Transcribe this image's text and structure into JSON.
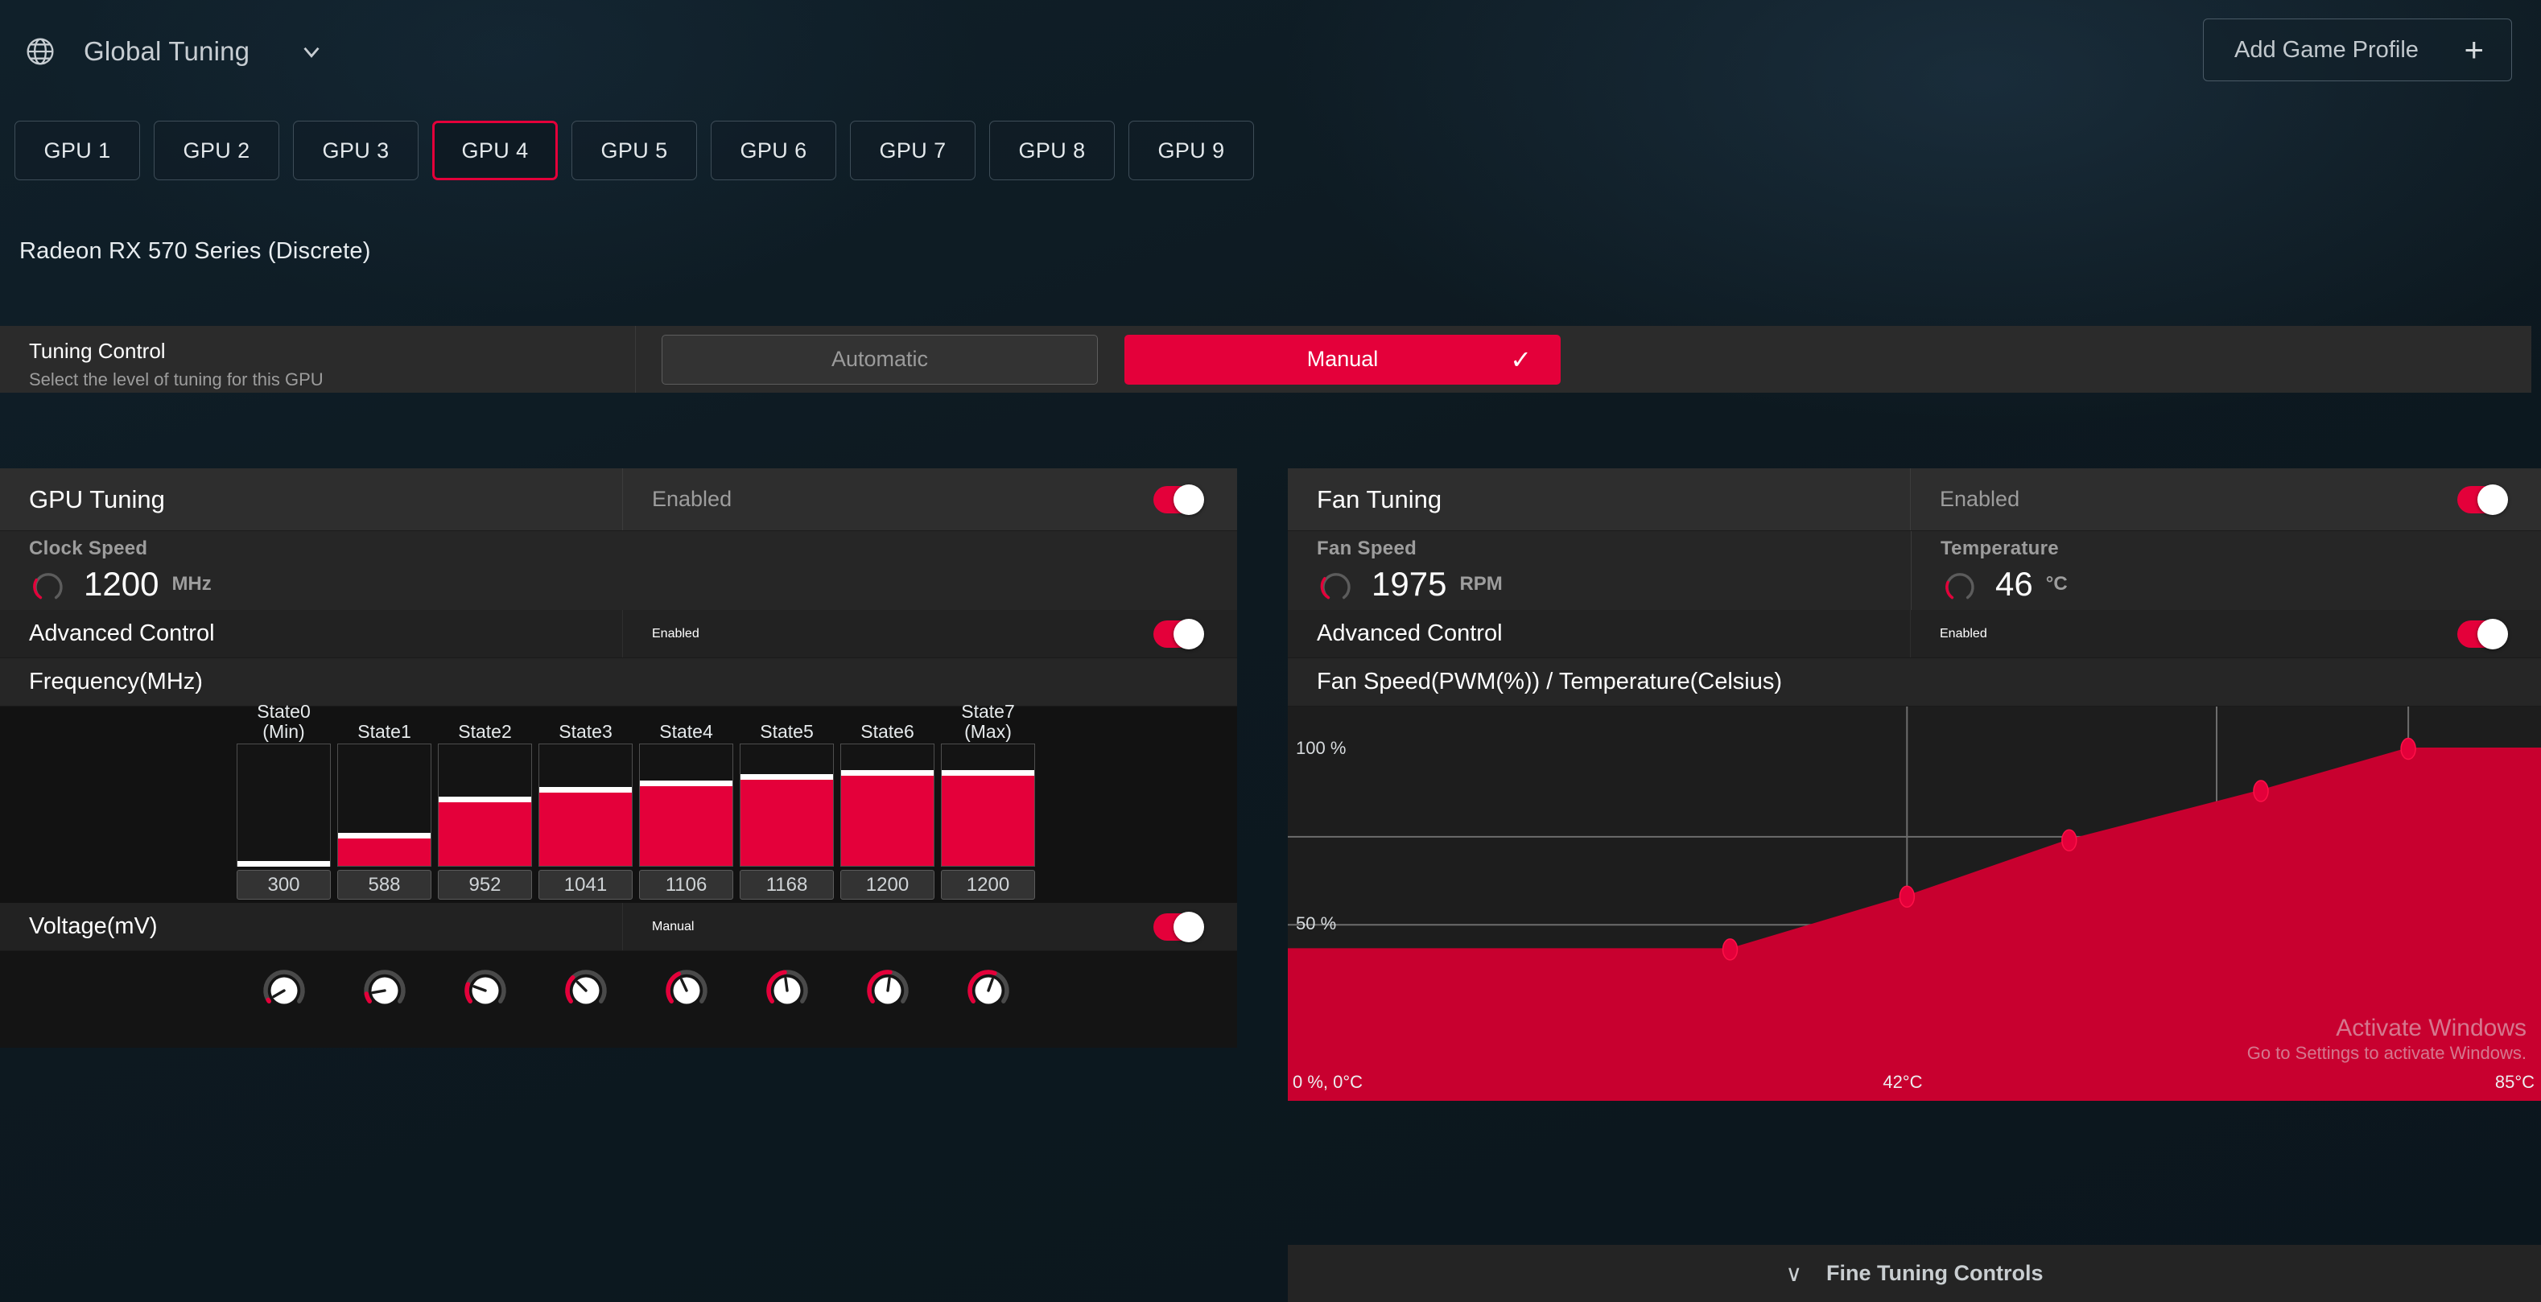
{
  "topbar": {
    "globe_icon": "globe-icon",
    "profile_name": "Global Tuning",
    "chevron_icon": "chevron-down-icon",
    "add_profile_label": "Add Game Profile",
    "add_profile_plus": "+"
  },
  "gpu_tabs": {
    "items": [
      {
        "label": "GPU 1",
        "selected": false
      },
      {
        "label": "GPU 2",
        "selected": false
      },
      {
        "label": "GPU 3",
        "selected": false
      },
      {
        "label": "GPU 4",
        "selected": true
      },
      {
        "label": "GPU 5",
        "selected": false
      },
      {
        "label": "GPU 6",
        "selected": false
      },
      {
        "label": "GPU 7",
        "selected": false
      },
      {
        "label": "GPU 8",
        "selected": false
      },
      {
        "label": "GPU 9",
        "selected": false
      }
    ],
    "selected_index": 3
  },
  "device": {
    "name": "Radeon RX 570 Series (Discrete)"
  },
  "tuning_control": {
    "title": "Tuning Control",
    "subtitle": "Select the level of tuning for this GPU",
    "automatic_label": "Automatic",
    "manual_label": "Manual",
    "selected": "Manual",
    "check_glyph": "✓"
  },
  "gpu_tuning": {
    "title": "GPU Tuning",
    "enabled_label": "Enabled",
    "enabled": true,
    "clock_speed": {
      "label": "Clock Speed",
      "value": "1200",
      "unit": "MHz",
      "gauge_pct": 38
    },
    "advanced_control": {
      "label": "Advanced Control",
      "state_label": "Enabled",
      "enabled": true
    },
    "frequency_label": "Frequency(MHz)",
    "voltage_label": "Voltage(mV)",
    "voltage_mode_label": "Manual",
    "voltage_enabled": true
  },
  "fan_tuning": {
    "title": "Fan Tuning",
    "enabled_label": "Enabled",
    "enabled": true,
    "fan_speed": {
      "label": "Fan Speed",
      "value": "1975",
      "unit": "RPM",
      "gauge_pct": 45
    },
    "temperature": {
      "label": "Temperature",
      "value": "46",
      "unit": "°C",
      "gauge_pct": 30
    },
    "curve_label": "Fan Speed(PWM(%)) / Temperature(Celsius)",
    "fine_tuning_label": "Fine Tuning Controls",
    "fine_tuning_chevron": "∨"
  },
  "watermark": {
    "title": "Activate Windows",
    "subtitle": "Go to Settings to activate Windows."
  },
  "chart_data": [
    {
      "type": "bar",
      "title": "Frequency(MHz)",
      "xlabel": "",
      "ylabel": "Frequency (MHz)",
      "categories": [
        "State0\n(Min)",
        "State1",
        "State2",
        "State3",
        "State4",
        "State5",
        "State6",
        "State7\n(Max)"
      ],
      "category_lines": [
        [
          "State0",
          "(Min)"
        ],
        [
          "State1",
          ""
        ],
        [
          "State2",
          ""
        ],
        [
          "State3",
          ""
        ],
        [
          "State4",
          ""
        ],
        [
          "State5",
          ""
        ],
        [
          "State6",
          ""
        ],
        [
          "State7",
          "(Max)"
        ]
      ],
      "values": [
        300,
        588,
        952,
        1041,
        1106,
        1168,
        1200,
        1200
      ],
      "value_labels": [
        "300",
        "588",
        "952",
        "1041",
        "1106",
        "1168",
        "1200",
        "1200"
      ],
      "fill_fractions": [
        0.012,
        0.245,
        0.545,
        0.62,
        0.675,
        0.73,
        0.76,
        0.76
      ],
      "bar_color": "#e4003a",
      "cap_color": "#ffffff",
      "grid": false,
      "ylim": [
        0,
        1580
      ]
    },
    {
      "type": "area",
      "title": "Fan Speed(PWM(%)) / Temperature(Celsius)",
      "xlabel": "Temperature (Celsius)",
      "ylabel": "Fan Speed (PWM %)",
      "x": [
        30,
        42,
        53,
        66,
        76
      ],
      "y": [
        43,
        58,
        74,
        88,
        100
      ],
      "point_labels": [
        "",
        "",
        "",
        "",
        ""
      ],
      "y_ticks": [
        "100 %",
        "50 %"
      ],
      "y_tick_values": [
        100,
        50
      ],
      "x_ticks": [
        "0 %, 0°C",
        "42°C",
        "85°C"
      ],
      "x_tick_values": [
        0,
        42,
        85
      ],
      "xlim": [
        0,
        85
      ],
      "ylim": [
        0,
        112
      ],
      "area_color": "#c8002f",
      "point_color": "#e4003a",
      "grid": true,
      "gridlines_x": [
        42,
        63,
        76
      ],
      "gridlines_y": [
        50,
        75
      ]
    }
  ]
}
